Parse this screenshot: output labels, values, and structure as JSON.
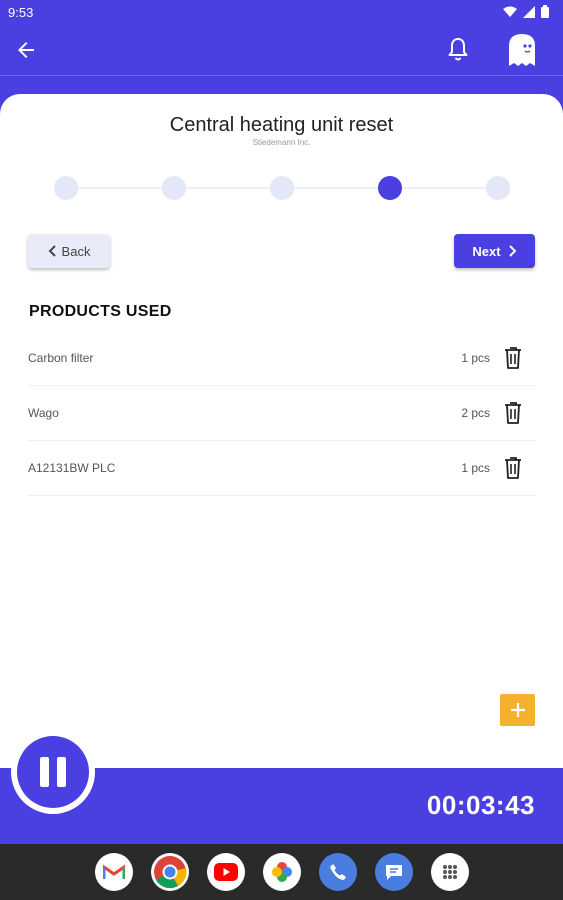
{
  "status": {
    "time": "9:53"
  },
  "header": {
    "title": "Central heating unit reset",
    "subtitle": "Stiedemann Inc."
  },
  "stepper": {
    "total_steps": 5,
    "current_step": 4
  },
  "nav": {
    "back_label": "Back",
    "next_label": "Next"
  },
  "products": {
    "heading": "PRODUCTS USED",
    "items": [
      {
        "name": "Carbon filter",
        "qty": "1 pcs"
      },
      {
        "name": "Wago",
        "qty": "2 pcs"
      },
      {
        "name": "A12131BW PLC",
        "qty": "1 pcs"
      }
    ]
  },
  "timer": {
    "value": "00:03:43"
  },
  "colors": {
    "primary": "#4A3FE0",
    "accent": "#F5B02E"
  },
  "dock": [
    "gmail-icon",
    "chrome-icon",
    "youtube-icon",
    "photos-icon",
    "phone-icon",
    "messages-icon",
    "apps-icon"
  ]
}
